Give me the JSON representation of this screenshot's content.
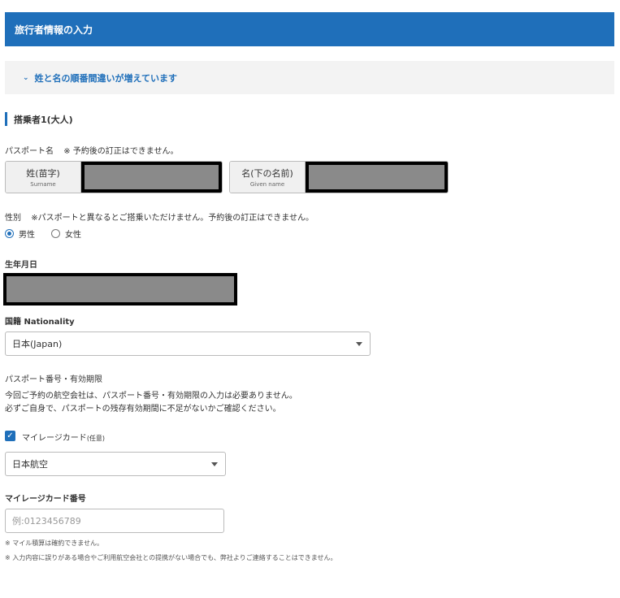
{
  "header": {
    "title": "旅行者情報の入力"
  },
  "notice": {
    "text": "姓と名の順番間違いが増えています"
  },
  "passenger": {
    "title": "搭乗者1(大人)"
  },
  "passport_name": {
    "label": "パスポート名",
    "note": "※ 予約後の訂正はできません。",
    "surname_jp": "姓(苗字)",
    "surname_en": "Surname",
    "given_jp": "名(下の名前)",
    "given_en": "Given name"
  },
  "gender": {
    "label": "性別",
    "note": "※パスポートと異なるとご搭乗いただけません。予約後の訂正はできません。",
    "options": [
      "男性",
      "女性"
    ],
    "selected": "男性"
  },
  "birthdate": {
    "label": "生年月日"
  },
  "nationality": {
    "label": "国籍 Nationality",
    "value": "日本(Japan)"
  },
  "passport_number": {
    "label": "パスポート番号・有効期限",
    "line1": "今回ご予約の航空会社は、パスポート番号・有効期限の入力は必要ありません。",
    "line2": "必ずご自身で、パスポートの残存有効期間に不足がないかご確認ください。"
  },
  "mileage": {
    "checkbox_label": "マイレージカード",
    "optional": "(任意)",
    "checked": true,
    "airline": "日本航空",
    "number_label": "マイレージカード番号",
    "number_placeholder": "例:0123456789"
  },
  "notes": [
    "※ マイル積算は確約できません。",
    "※ 入力内容に誤りがある場合やご利用航空会社との提携がない場合でも、弊社よりご連絡することはできません。"
  ],
  "colors": {
    "accent": "#1f6fba",
    "redacted": "#8a8a8a"
  }
}
